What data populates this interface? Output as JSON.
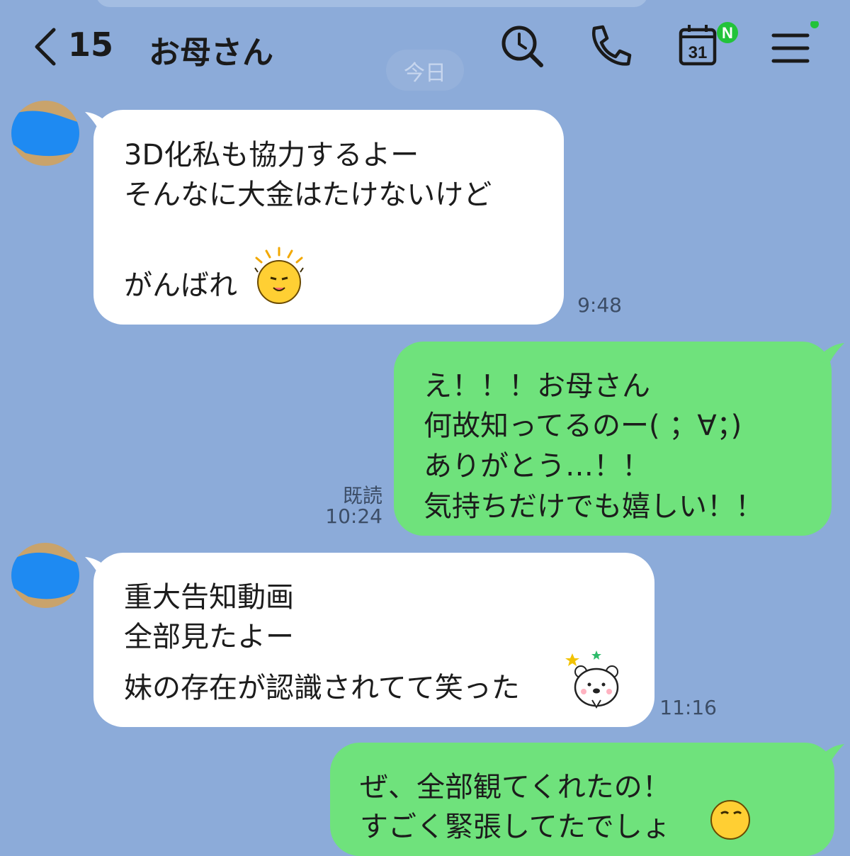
{
  "header": {
    "back_count": "15",
    "title": "お母さん",
    "calendar_day": "31",
    "calendar_badge": "N"
  },
  "date_divider": "今日",
  "messages": [
    {
      "side": "left",
      "lines": [
        "3D化私も協力するよー",
        "そんなに大金はたけないけど",
        "",
        "がんばれ"
      ],
      "time": "9:48"
    },
    {
      "side": "right",
      "lines": [
        "え！！！お母さん",
        "何故知ってるのー( ；∀；)",
        "ありがとう…！！",
        "気持ちだけでも嬉しい！！"
      ],
      "read": "既読",
      "time": "10:24"
    },
    {
      "side": "left",
      "lines": [
        "重大告知動画",
        "全部見たよー",
        "妹の存在が認識されてて笑った"
      ],
      "time": "11:16"
    },
    {
      "side": "right",
      "lines": [
        "ぜ、全部観てくれたの！",
        "すごく緊張してたでしょ"
      ]
    }
  ],
  "colors": {
    "background": "#8cabd9",
    "incoming_bubble": "#ffffff",
    "outgoing_bubble": "#6fe27c",
    "badge": "#22c33a"
  },
  "icons": [
    "back-chevron-icon",
    "search-clock-icon",
    "phone-icon",
    "calendar-icon",
    "menu-icon",
    "avatar",
    "cheer-emoji-icon",
    "bear-emoji-icon",
    "thinking-emoji-icon"
  ]
}
